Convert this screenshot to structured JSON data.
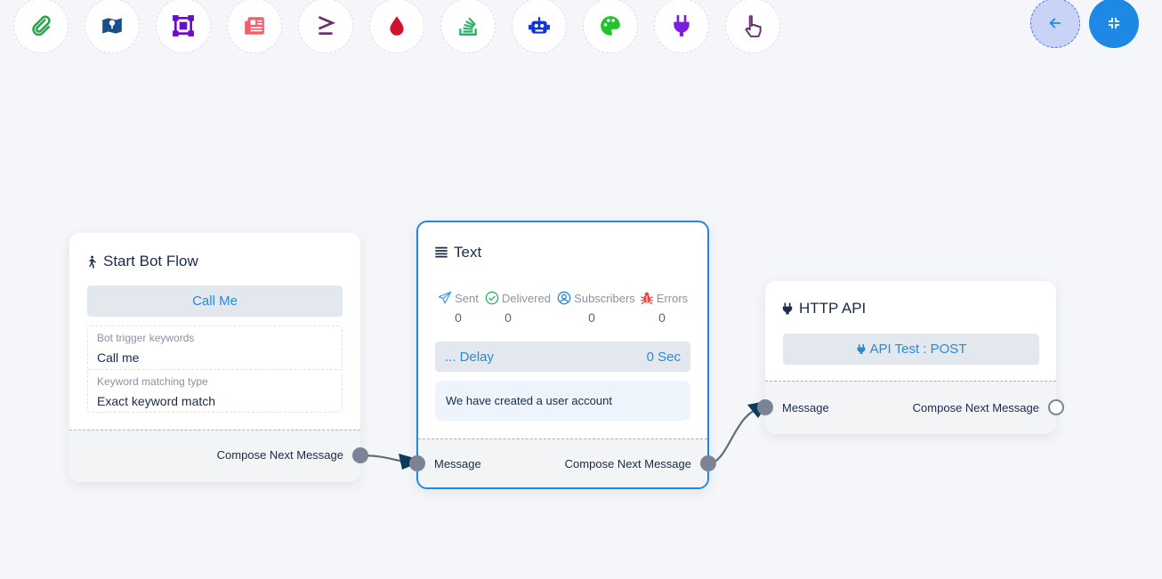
{
  "toolbar": {
    "icons": [
      {
        "name": "attachment-icon",
        "color": "#2ea44f"
      },
      {
        "name": "map-icon",
        "color": "#1b4f8a"
      },
      {
        "name": "vector-square-icon",
        "color": "#6a0dc9"
      },
      {
        "name": "newspaper-icon",
        "color": "#f05f6b"
      },
      {
        "name": "greater-equal-icon",
        "color": "#6c2f6f"
      },
      {
        "name": "drop-icon",
        "color": "#d1122f"
      },
      {
        "name": "stack-icon",
        "color": "#28b463"
      },
      {
        "name": "robot-icon",
        "color": "#1034d6"
      },
      {
        "name": "palette-icon",
        "color": "#21c32c"
      },
      {
        "name": "plug-icon",
        "color": "#7a1ee0"
      },
      {
        "name": "hand-pointer-icon",
        "color": "#6c2f6f"
      }
    ],
    "back_icon": "arrow-left-icon",
    "collapse_icon": "compress-icon"
  },
  "start_node": {
    "title": "Start Bot Flow",
    "button": "Call Me",
    "fields": [
      {
        "label": "Bot trigger keywords",
        "value": "Call me"
      },
      {
        "label": "Keyword matching type",
        "value": "Exact keyword match"
      }
    ],
    "footer": "Compose Next Message"
  },
  "text_node": {
    "title": "Text",
    "stats": [
      {
        "label": "Sent",
        "value": "0"
      },
      {
        "label": "Delivered",
        "value": "0"
      },
      {
        "label": "Subscribers",
        "value": "0"
      },
      {
        "label": "Errors",
        "value": "0"
      }
    ],
    "delay_label": "... Delay",
    "delay_value": "0 Sec",
    "message": "We have created a user account",
    "input_label": "Message",
    "output_label": "Compose Next Message"
  },
  "api_node": {
    "title": "HTTP API",
    "button": "API Test : POST",
    "input_label": "Message",
    "output_label": "Compose Next Message"
  },
  "colors": {
    "accent": "#1e88e5",
    "node_border": "#1e88e5",
    "connector": "#7b8494"
  }
}
